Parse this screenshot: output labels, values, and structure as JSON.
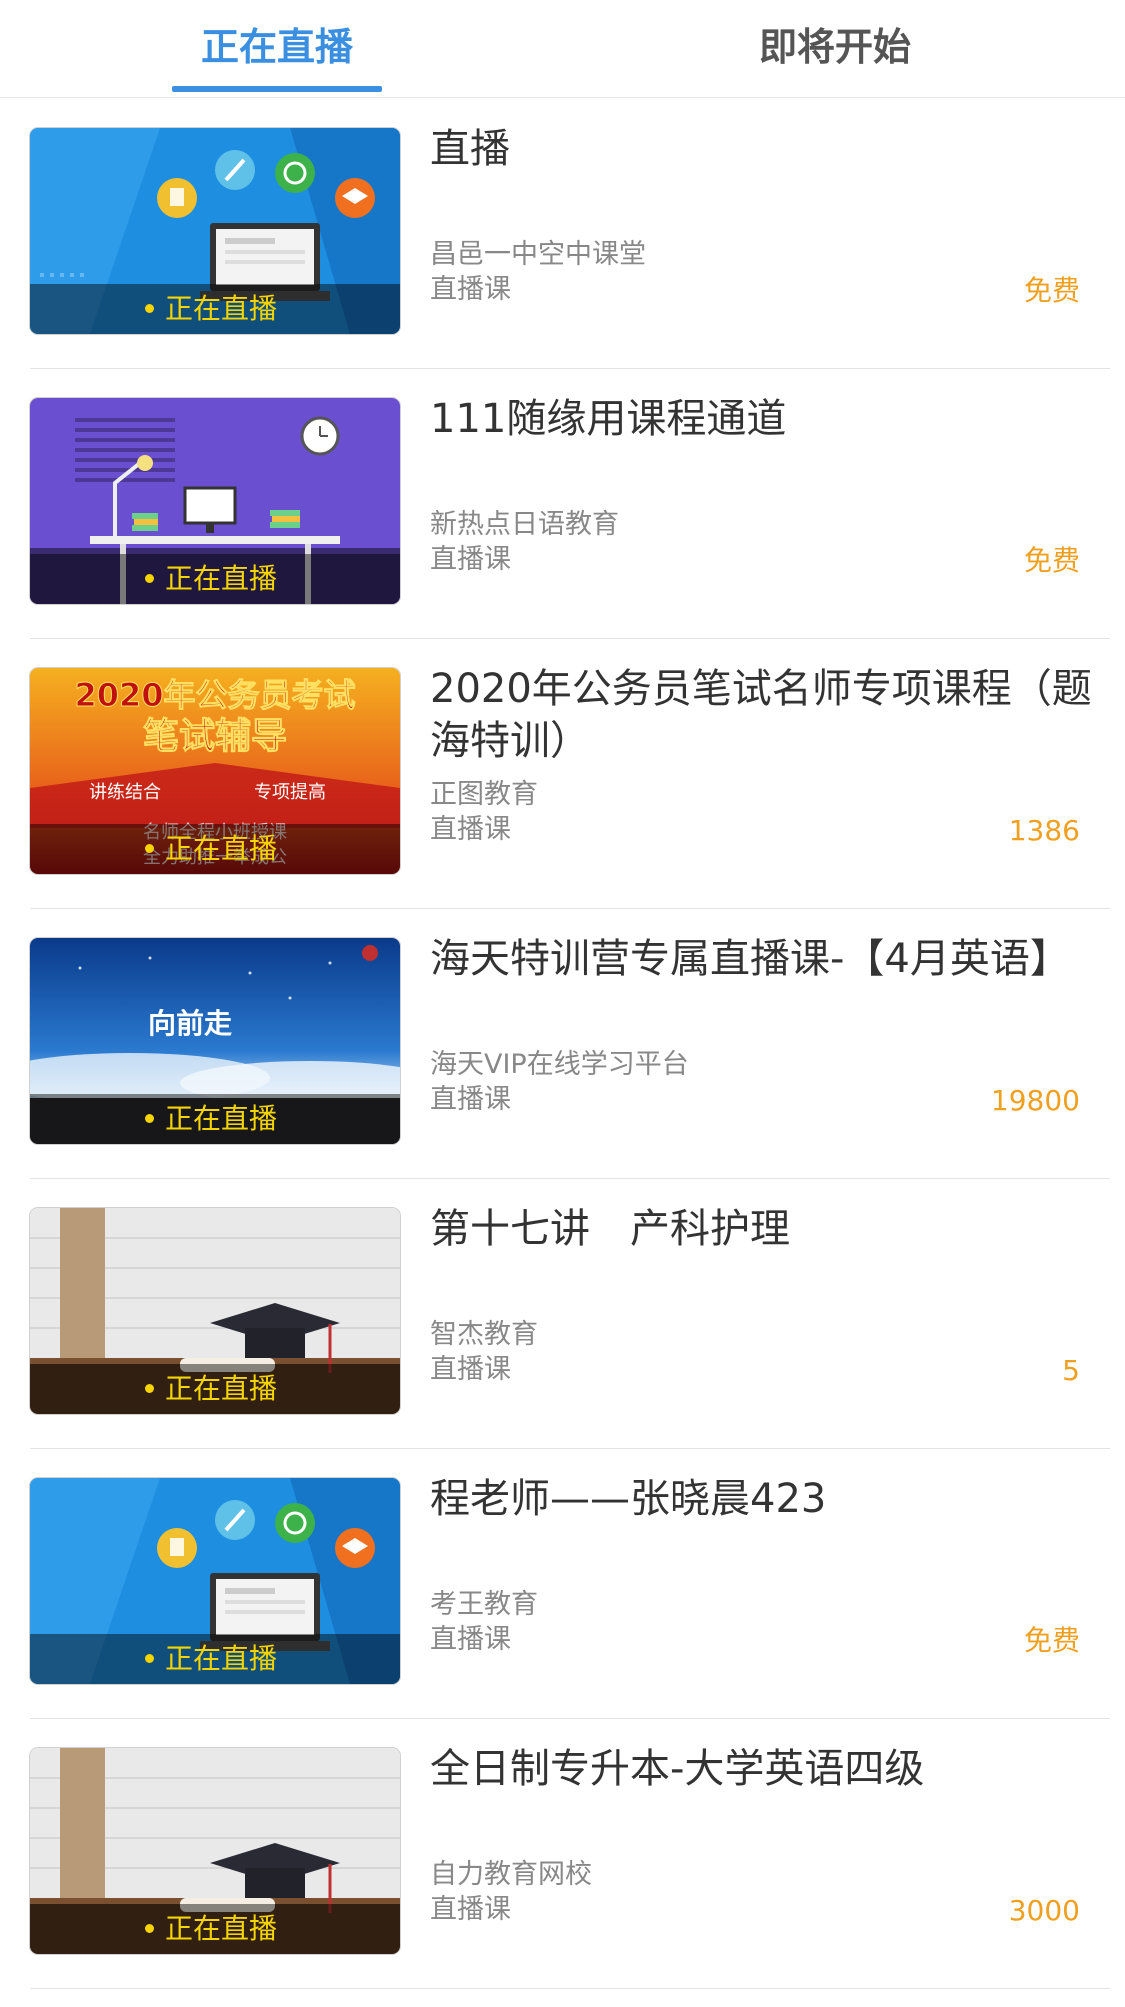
{
  "tabs": {
    "live": "正在直播",
    "upcoming": "即将开始"
  },
  "badge": "正在直播",
  "colors": {
    "accent": "#3b8fe0",
    "price": "#f0a020",
    "badge": "#f5d400"
  },
  "courses": [
    {
      "title": "直播",
      "org": "昌邑一中空中课堂",
      "type": "直播课",
      "price": "免费",
      "thumb": "classroom-blue"
    },
    {
      "title": "111随缘用课程通道",
      "org": "新热点日语教育",
      "type": "直播课",
      "price": "免费",
      "thumb": "desk-purple"
    },
    {
      "title": "2020年公务员笔试名师专项课程（题海特训）",
      "org": "正图教育",
      "type": "直播课",
      "price": "1386",
      "thumb": "exam-banner",
      "banner": {
        "line1": "2020年公务员考试",
        "line2": "笔试辅导",
        "left": "讲练结合",
        "right": "专项提高",
        "foot1": "名师全程小班授课",
        "foot2": "全力助推一举成公"
      }
    },
    {
      "title": "海天特训营专属直播课-【4月英语】",
      "org": "海天VIP在线学习平台",
      "type": "直播课",
      "price": "19800",
      "thumb": "sky-forward",
      "banner": {
        "line1": "向前走"
      }
    },
    {
      "title": "第十七讲　产科护理",
      "org": "智杰教育",
      "type": "直播课",
      "price": "5",
      "thumb": "graduation-cap"
    },
    {
      "title": "程老师——张晓晨423",
      "org": "考王教育",
      "type": "直播课",
      "price": "免费",
      "thumb": "classroom-blue"
    },
    {
      "title": "全日制专升本-大学英语四级",
      "org": "自力教育网校",
      "type": "直播课",
      "price": "3000",
      "thumb": "graduation-cap"
    }
  ]
}
